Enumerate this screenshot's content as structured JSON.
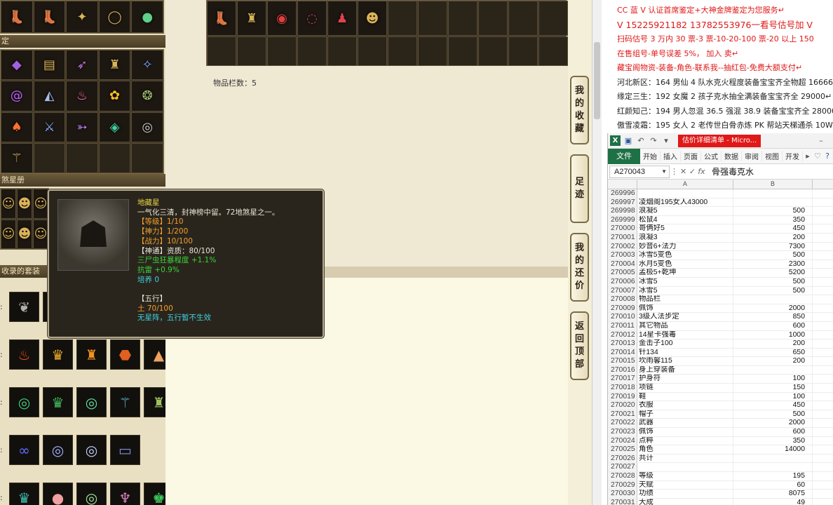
{
  "left_panel": {
    "section_1": "定",
    "section_2": "煞星册",
    "section_3": "收录的套装",
    "row_marks": [
      ":",
      ":",
      ":",
      ":",
      ":"
    ]
  },
  "inventory": {
    "count_label": "物品栏数：5"
  },
  "side_tabs": [
    {
      "chars": [
        "我",
        "的",
        "收",
        "藏"
      ]
    },
    {
      "chars": [
        "足",
        "迹"
      ]
    },
    {
      "chars": [
        "我",
        "的",
        "还",
        "价"
      ]
    },
    {
      "chars": [
        "返",
        "回",
        "顶",
        "部"
      ]
    }
  ],
  "tooltip": {
    "name": "地藏星",
    "desc": "一气化三清，封神榜中留。72地煞星之一。",
    "level": "【等级】1/10",
    "divine_power": "【神力】1/200",
    "combat": "【战力】10/100",
    "talent": "【神通】资质：80/100",
    "bonus_1": "三尸虫狂暴程度 +1.1%",
    "bonus_2": "抗雷 +0.9%",
    "cultivate": "培养 0",
    "elements_title": "【五行】",
    "element": "土 70/100",
    "element_note": "无星阵，五行暂不生效"
  },
  "ads": [
    {
      "text": "CC 蓝 V 认证首席鉴定+大神金牌鉴定为您服务↵",
      "color": "red"
    },
    {
      "text": "V 15225921182      13782553976一看号估号加 V",
      "color": "red"
    },
    {
      "text": "扫码估号 3 万内 30 票-3        票-10-20-100 票-20 以上 150",
      "color": "red"
    },
    {
      "text": "在售组号-单号误差 5%，        加入                                 卖↵",
      "color": "red"
    },
    {
      "text": "藏宝阁物资-装备-角色-联系我--抽红包-免费大额支付↵",
      "color": "red"
    },
    {
      "text": "河北新区：164 男仙 4 队水克火程度装备宝宝齐全物超 16666",
      "color": "dark"
    },
    {
      "text": "缘定三生：192 女魔 2 孩子克水抽全满装备宝宝齐全 29000↵",
      "color": "dark"
    },
    {
      "text": "红颜知己：194 男人忽混 36.5 强混 38.9 装备宝宝齐全 28000↵",
      "color": "dark"
    },
    {
      "text": "傲雪凌霜：195 女人 2 老传世白骨赤炼 PK 帮站天梯通杀 10W",
      "color": "dark"
    }
  ],
  "excel": {
    "logo": "X",
    "taskbar_title": "估价详细清单 - Micro...",
    "ribbon_file": "文件",
    "ribbon_tabs": [
      "开始",
      "插入",
      "页面",
      "公式",
      "数据",
      "审阅",
      "视图",
      "开发"
    ],
    "name_box": "A270043",
    "formula_value": "骨强毒克水",
    "col_a": "A",
    "col_b": "B",
    "rows": [
      {
        "n": "269996",
        "a": "",
        "b": ""
      },
      {
        "n": "269997",
        "a": "凌烟阁195女人43000",
        "b": ""
      },
      {
        "n": "269998",
        "a": "浪凝5",
        "b": "500"
      },
      {
        "n": "269999",
        "a": "松鼠4",
        "b": "350"
      },
      {
        "n": "270000",
        "a": "哥俩好5",
        "b": "450"
      },
      {
        "n": "270001",
        "a": "浪凝3",
        "b": "200"
      },
      {
        "n": "270002",
        "a": "妙音6+法力",
        "b": "7300"
      },
      {
        "n": "270003",
        "a": "冰雪5变色",
        "b": "500"
      },
      {
        "n": "270004",
        "a": "水月5变色",
        "b": "2300"
      },
      {
        "n": "270005",
        "a": "孟极5+乾坤",
        "b": "5200"
      },
      {
        "n": "270006",
        "a": "冰雪5",
        "b": "500"
      },
      {
        "n": "270007",
        "a": "冰雪5",
        "b": "500"
      },
      {
        "n": "270008",
        "a": "物品栏",
        "b": ""
      },
      {
        "n": "270009",
        "a": "佩饰",
        "b": "2000"
      },
      {
        "n": "270010",
        "a": "3级人法步定",
        "b": "850"
      },
      {
        "n": "270011",
        "a": "其它物品",
        "b": "600"
      },
      {
        "n": "270012",
        "a": "14星卡强毒",
        "b": "1000"
      },
      {
        "n": "270013",
        "a": "金击子100",
        "b": "200"
      },
      {
        "n": "270014",
        "a": "针134",
        "b": "650"
      },
      {
        "n": "270015",
        "a": "坎雨馨115",
        "b": "200"
      },
      {
        "n": "270016",
        "a": "身上穿装备",
        "b": ""
      },
      {
        "n": "270017",
        "a": "护身符",
        "b": "100"
      },
      {
        "n": "270018",
        "a": "项链",
        "b": "150"
      },
      {
        "n": "270019",
        "a": "鞋",
        "b": "100"
      },
      {
        "n": "270020",
        "a": "衣服",
        "b": "450"
      },
      {
        "n": "270021",
        "a": "帽子",
        "b": "500"
      },
      {
        "n": "270022",
        "a": "武器",
        "b": "2000"
      },
      {
        "n": "270023",
        "a": "佩饰",
        "b": "600"
      },
      {
        "n": "270024",
        "a": "点粹",
        "b": "350"
      },
      {
        "n": "270025",
        "a": "角色",
        "b": "14000"
      },
      {
        "n": "270026",
        "a": "共计",
        "b": ""
      },
      {
        "n": "270027",
        "a": "",
        "b": ""
      },
      {
        "n": "270028",
        "a": "等级",
        "b": "195"
      },
      {
        "n": "270029",
        "a": "天赋",
        "b": "60"
      },
      {
        "n": "270030",
        "a": "功绩",
        "b": "8075"
      },
      {
        "n": "270031",
        "a": "大成",
        "b": "49"
      }
    ]
  },
  "colors": {
    "excel_green": "#1e7145",
    "ad_red": "#e01818",
    "tooltip_bg": "#2a251c"
  }
}
